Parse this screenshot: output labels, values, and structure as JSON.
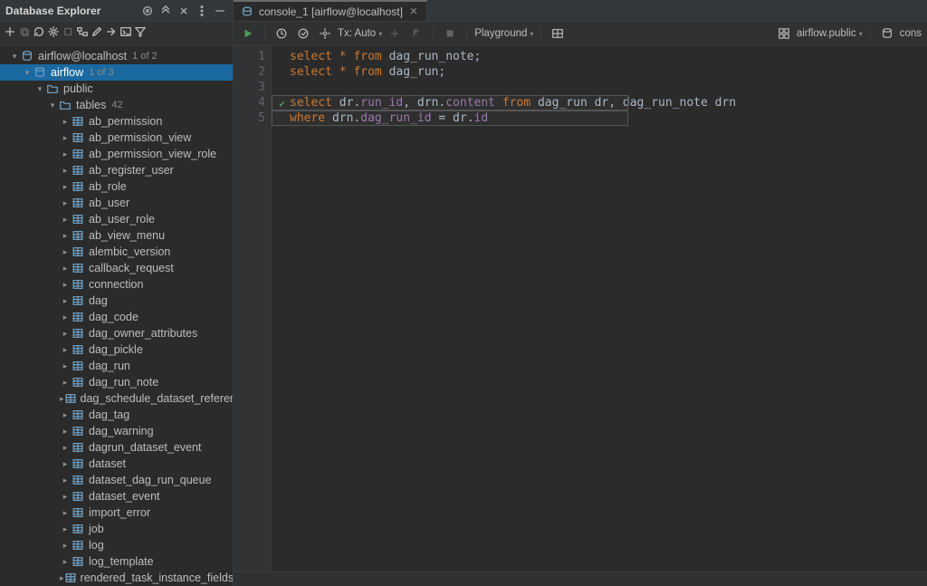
{
  "sidebar": {
    "title": "Database Explorer",
    "header_icons": [
      "target-icon",
      "chevrons-up-icon",
      "collapse-icon",
      "more-icon",
      "minimize-icon"
    ],
    "toolbar_icons": [
      "add-icon",
      "copy-icon-disabled",
      "refresh-icon",
      "gear-icon",
      "stop-icon-disabled",
      "grid-icon",
      "edit-icon",
      "jump-icon",
      "console-icon",
      "filter-icon"
    ],
    "root": {
      "label": "airflow@localhost",
      "suffix": "1 of 2",
      "children": [
        {
          "label": "airflow",
          "suffix": "1 of 3",
          "selected": true,
          "children": [
            {
              "label": "public",
              "children": [
                {
                  "label": "tables",
                  "suffix": "42",
                  "children": [
                    {
                      "label": "ab_permission"
                    },
                    {
                      "label": "ab_permission_view"
                    },
                    {
                      "label": "ab_permission_view_role"
                    },
                    {
                      "label": "ab_register_user"
                    },
                    {
                      "label": "ab_role"
                    },
                    {
                      "label": "ab_user"
                    },
                    {
                      "label": "ab_user_role"
                    },
                    {
                      "label": "ab_view_menu"
                    },
                    {
                      "label": "alembic_version"
                    },
                    {
                      "label": "callback_request"
                    },
                    {
                      "label": "connection"
                    },
                    {
                      "label": "dag"
                    },
                    {
                      "label": "dag_code"
                    },
                    {
                      "label": "dag_owner_attributes"
                    },
                    {
                      "label": "dag_pickle"
                    },
                    {
                      "label": "dag_run"
                    },
                    {
                      "label": "dag_run_note"
                    },
                    {
                      "label": "dag_schedule_dataset_reference"
                    },
                    {
                      "label": "dag_tag"
                    },
                    {
                      "label": "dag_warning"
                    },
                    {
                      "label": "dagrun_dataset_event"
                    },
                    {
                      "label": "dataset"
                    },
                    {
                      "label": "dataset_dag_run_queue"
                    },
                    {
                      "label": "dataset_event"
                    },
                    {
                      "label": "import_error"
                    },
                    {
                      "label": "job"
                    },
                    {
                      "label": "log"
                    },
                    {
                      "label": "log_template"
                    },
                    {
                      "label": "rendered_task_instance_fields"
                    }
                  ]
                }
              ]
            }
          ]
        }
      ]
    }
  },
  "tab": {
    "label": "console_1 [airflow@localhost]"
  },
  "toolbar": {
    "tx_label": "Tx: Auto",
    "playground_label": "Playground",
    "schema_label": "airflow.public",
    "right_label": "cons"
  },
  "code": {
    "lines": [
      {
        "n": "1",
        "tokens": [
          {
            "t": "select ",
            "c": "kw"
          },
          {
            "t": "* ",
            "c": "st"
          },
          {
            "t": "from ",
            "c": "kw"
          },
          {
            "t": "dag_run_note",
            "c": "id"
          },
          {
            "t": ";",
            "c": "id"
          }
        ]
      },
      {
        "n": "2",
        "tokens": [
          {
            "t": "select ",
            "c": "kw"
          },
          {
            "t": "* ",
            "c": "st"
          },
          {
            "t": "from ",
            "c": "kw"
          },
          {
            "t": "dag_run",
            "c": "id"
          },
          {
            "t": ";",
            "c": "id"
          }
        ]
      },
      {
        "n": "3",
        "tokens": []
      },
      {
        "n": "4",
        "check": true,
        "hl": true,
        "tokens": [
          {
            "t": "select ",
            "c": "kw"
          },
          {
            "t": "dr.",
            "c": "id"
          },
          {
            "t": "run_id",
            "c": "col"
          },
          {
            "t": ", dr",
            "c": "id"
          },
          {
            "t": "n.",
            "c": "id"
          },
          {
            "t": "content ",
            "c": "col"
          },
          {
            "t": "from ",
            "c": "kw"
          },
          {
            "t": "dag_run dr, dag_run_note drn",
            "c": "id"
          }
        ]
      },
      {
        "n": "5",
        "hl": true,
        "tokens": [
          {
            "t": "where ",
            "c": "kw"
          },
          {
            "t": "drn.",
            "c": "id"
          },
          {
            "t": "dag_run_id",
            "c": "col"
          },
          {
            "t": " = dr.",
            "c": "id"
          },
          {
            "t": "id",
            "c": "col"
          }
        ]
      }
    ]
  }
}
